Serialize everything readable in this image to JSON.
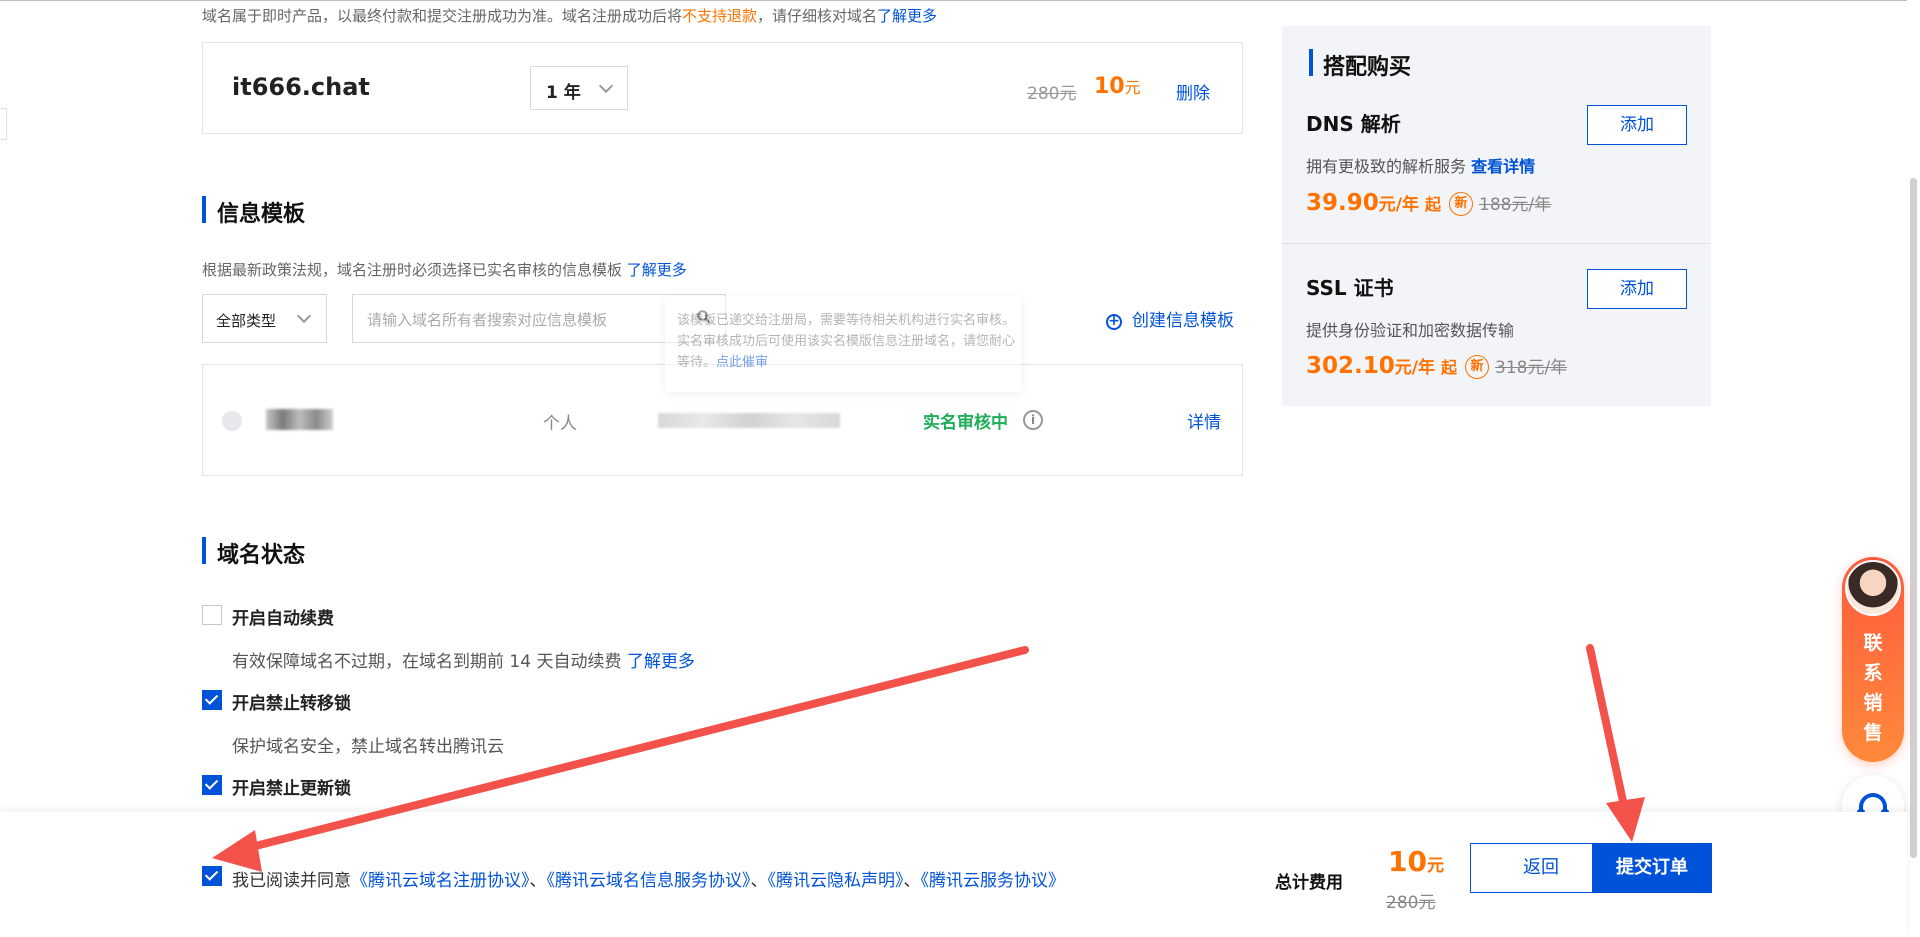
{
  "notice": {
    "prefix": "域名属于即时产品，以最终付款和提交注册成功为准。域名注册成功后将",
    "warning": "不支持退款",
    "suffix": "，请仔细核对域名",
    "link": "了解更多"
  },
  "domain": {
    "name": "it666.chat",
    "period": "1 年",
    "original_price": "280元",
    "price": "10",
    "price_unit": "元",
    "delete_label": "删除"
  },
  "info_template": {
    "title": "信息模板",
    "policy_text": "根据最新政策法规，域名注册时必须选择已实名审核的信息模板",
    "policy_link": "了解更多",
    "type_filter": "全部类型",
    "search_placeholder": "请输入域名所有者搜索对应信息模板",
    "create_label": "创建信息模板",
    "tooltip_text": "该模板已递交给注册局，需要等待相关机构进行实名审核。实名审核成功后可使用该实名模版信息注册域名，请您耐心等待。",
    "tooltip_link": "点此催审",
    "row": {
      "type": "个人",
      "status": "实名审核中",
      "detail_label": "详情"
    }
  },
  "domain_status": {
    "title": "域名状态",
    "options": [
      {
        "label": "开启自动续费",
        "checked": false,
        "desc": "有效保障域名不过期，在域名到期前 14 天自动续费",
        "desc_link": "了解更多"
      },
      {
        "label": "开启禁止转移锁",
        "checked": true,
        "desc": "保护域名安全，禁止域名转出腾讯云",
        "desc_link": ""
      },
      {
        "label": "开启禁止更新锁",
        "checked": true,
        "desc": "",
        "desc_link": ""
      }
    ]
  },
  "side_panel": {
    "title": "搭配购买",
    "addons": [
      {
        "name": "DNS 解析",
        "desc": "拥有更极致的解析服务",
        "desc_link": "查看详情",
        "price": "39.90",
        "unit": "元/年",
        "qi": "起",
        "new_badge": "新",
        "old_price": "188元/年",
        "add_label": "添加"
      },
      {
        "name": "SSL 证书",
        "desc": "提供身份验证和加密数据传输",
        "desc_link": "",
        "price": "302.10",
        "unit": "元/年",
        "qi": "起",
        "new_badge": "新",
        "old_price": "318元/年",
        "add_label": "添加"
      }
    ]
  },
  "contact": {
    "text": "联系销售"
  },
  "footer": {
    "agree_prefix": "我已阅读并同意",
    "agreements": [
      "《腾讯云域名注册协议》",
      "《腾讯云域名信息服务协议》",
      "《腾讯云隐私声明》",
      "《腾讯云服务协议》"
    ],
    "separator": "、",
    "agree_checked": true,
    "total_label": "总计费用",
    "total_price": "10",
    "total_unit": "元",
    "total_old": "280元",
    "back_label": "返回",
    "submit_label": "提交订单"
  },
  "colors": {
    "accent": "#0052d9",
    "price": "#ff7200",
    "success": "#1fae58",
    "annotation_arrow": "#f2524a"
  }
}
